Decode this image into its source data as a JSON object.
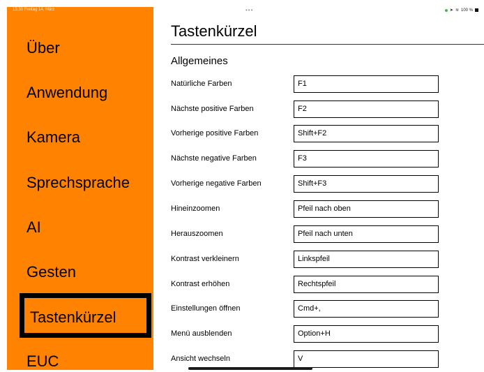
{
  "status_bar": {
    "time_date": "13:30  Freitag 14. März",
    "dots": "•••",
    "battery_text": "100 %"
  },
  "sidebar": {
    "items": [
      {
        "label": "Über"
      },
      {
        "label": "Anwendung"
      },
      {
        "label": "Kamera"
      },
      {
        "label": "Sprechsprache"
      },
      {
        "label": "AI"
      },
      {
        "label": "Gesten"
      },
      {
        "label": "Tastenkürzel",
        "selected": true
      },
      {
        "label": "EUC"
      }
    ]
  },
  "main": {
    "title": "Tastenkürzel",
    "section": "Allgemeines",
    "shortcuts": [
      {
        "label": "Natürliche Farben",
        "value": "F1"
      },
      {
        "label": "Nächste positive Farben",
        "value": "F2"
      },
      {
        "label": "Vorherige positive Farben",
        "value": "Shift+F2"
      },
      {
        "label": "Nächste negative Farben",
        "value": "F3"
      },
      {
        "label": "Vorherige negative Farben",
        "value": "Shift+F3"
      },
      {
        "label": "Hineinzoomen",
        "value": "Pfeil nach oben"
      },
      {
        "label": "Herauszoomen",
        "value": "Pfeil nach unten"
      },
      {
        "label": "Kontrast verkleinern",
        "value": "Linkspfeil"
      },
      {
        "label": "Kontrast erhöhen",
        "value": "Rechtspfeil"
      },
      {
        "label": "Einstellungen öffnen",
        "value": "Cmd+,"
      },
      {
        "label": "Menü ausblenden",
        "value": "Option+H"
      },
      {
        "label": "Ansicht wechseln",
        "value": "V"
      }
    ]
  },
  "colors": {
    "sidebar_bg": "#ff8200",
    "selection_border": "#000000"
  }
}
